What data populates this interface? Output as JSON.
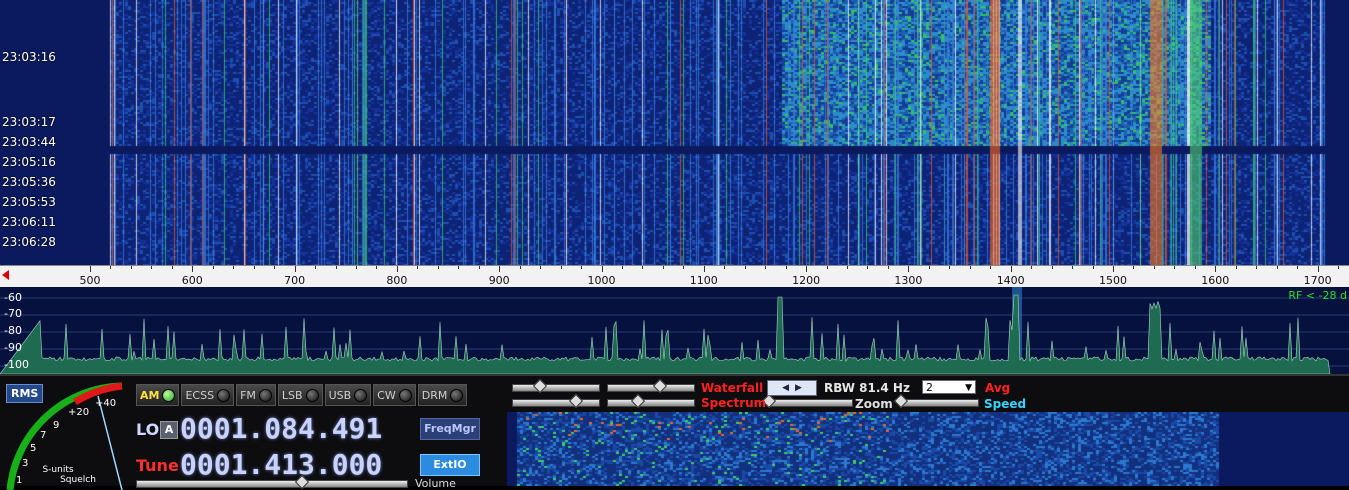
{
  "waterfall": {
    "timestamps": [
      "23:03:16",
      "23:03:17",
      "23:03:44",
      "23:05:16",
      "23:05:36",
      "23:05:53",
      "23:06:11",
      "23:06:28"
    ]
  },
  "freq_scale": {
    "ticks": [
      "500",
      "600",
      "700",
      "800",
      "900",
      "1000",
      "1100",
      "1200",
      "1300",
      "1400",
      "1500",
      "1600",
      "1700"
    ]
  },
  "spectrum": {
    "db_labels": [
      "-60",
      "-70",
      "-80",
      "-90",
      "-100"
    ],
    "rf_label": "RF < -28 d"
  },
  "controls": {
    "rms_label": "RMS",
    "smeter_label": "S-units\nSquelch",
    "smeter_scale": [
      "+40",
      "+20",
      "9",
      "7",
      "5",
      "3",
      "1"
    ],
    "modes": [
      {
        "label": "AM",
        "active": true
      },
      {
        "label": "ECSS",
        "active": false
      },
      {
        "label": "FM",
        "active": false
      },
      {
        "label": "LSB",
        "active": false
      },
      {
        "label": "USB",
        "active": false
      },
      {
        "label": "CW",
        "active": false
      },
      {
        "label": "DRM",
        "active": false
      }
    ],
    "lo_label": "LO",
    "lo_lock": "A",
    "lo_freq": "0001.084.491",
    "tune_label": "Tune",
    "tune_freq": "0001.413.000",
    "freqmgr_label": "FreqMgr",
    "extio_label": "ExtIO",
    "waterfall_label": "Waterfall",
    "spectrum_label": "Spectrum",
    "zoom_label": "Zoom",
    "speed_label": "Speed",
    "rbw_label": "RBW 81.4 Hz",
    "avg_value": "2",
    "avg_label": "Avg",
    "volume_label": "Volume"
  },
  "colors": {
    "waterfall_bg": "#0b1a5e",
    "accent_red": "#ff2020",
    "accent_cyan": "#38d4ff"
  }
}
